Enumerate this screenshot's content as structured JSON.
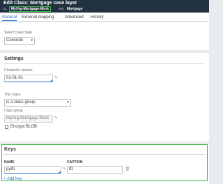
{
  "header": {
    "title": "Edit  Class: Mortgage case layer",
    "class_badge": "CL",
    "class_name": "MyOrg-Mortgage-Work",
    "ruleset_badge": "RS",
    "ruleset": "Mortgage"
  },
  "tabs": [
    {
      "label": "General",
      "active": true
    },
    {
      "label": "External mapping",
      "active": false
    },
    {
      "label": "Advanced",
      "active": false
    },
    {
      "label": "History",
      "active": false
    }
  ],
  "class_type": {
    "label": "Select Class Type",
    "value": "Concrete"
  },
  "settings": {
    "title": "Settings",
    "created_label": "Created in version",
    "created_value": "01-01-01",
    "this_class_label": "This Class",
    "this_class_value": "is a class group",
    "class_group_label": "Class group",
    "class_group_value": "MyOrg-Mortgage-Work",
    "encrypt_label": "Encrypt BLOB",
    "encrypt_checked": false
  },
  "keys": {
    "title": "Keys",
    "name_header": "NAME",
    "caption_header": "CAPTION",
    "rows": [
      {
        "name": "pyID",
        "caption": "ID"
      }
    ],
    "add_label": "+ Add key"
  },
  "colors": {
    "header_bg": "#233241",
    "highlight": "#35b53f",
    "accent": "#2a74c6"
  },
  "icons": [
    "pencil-icon",
    "chevron-down-icon",
    "trash-icon"
  ]
}
